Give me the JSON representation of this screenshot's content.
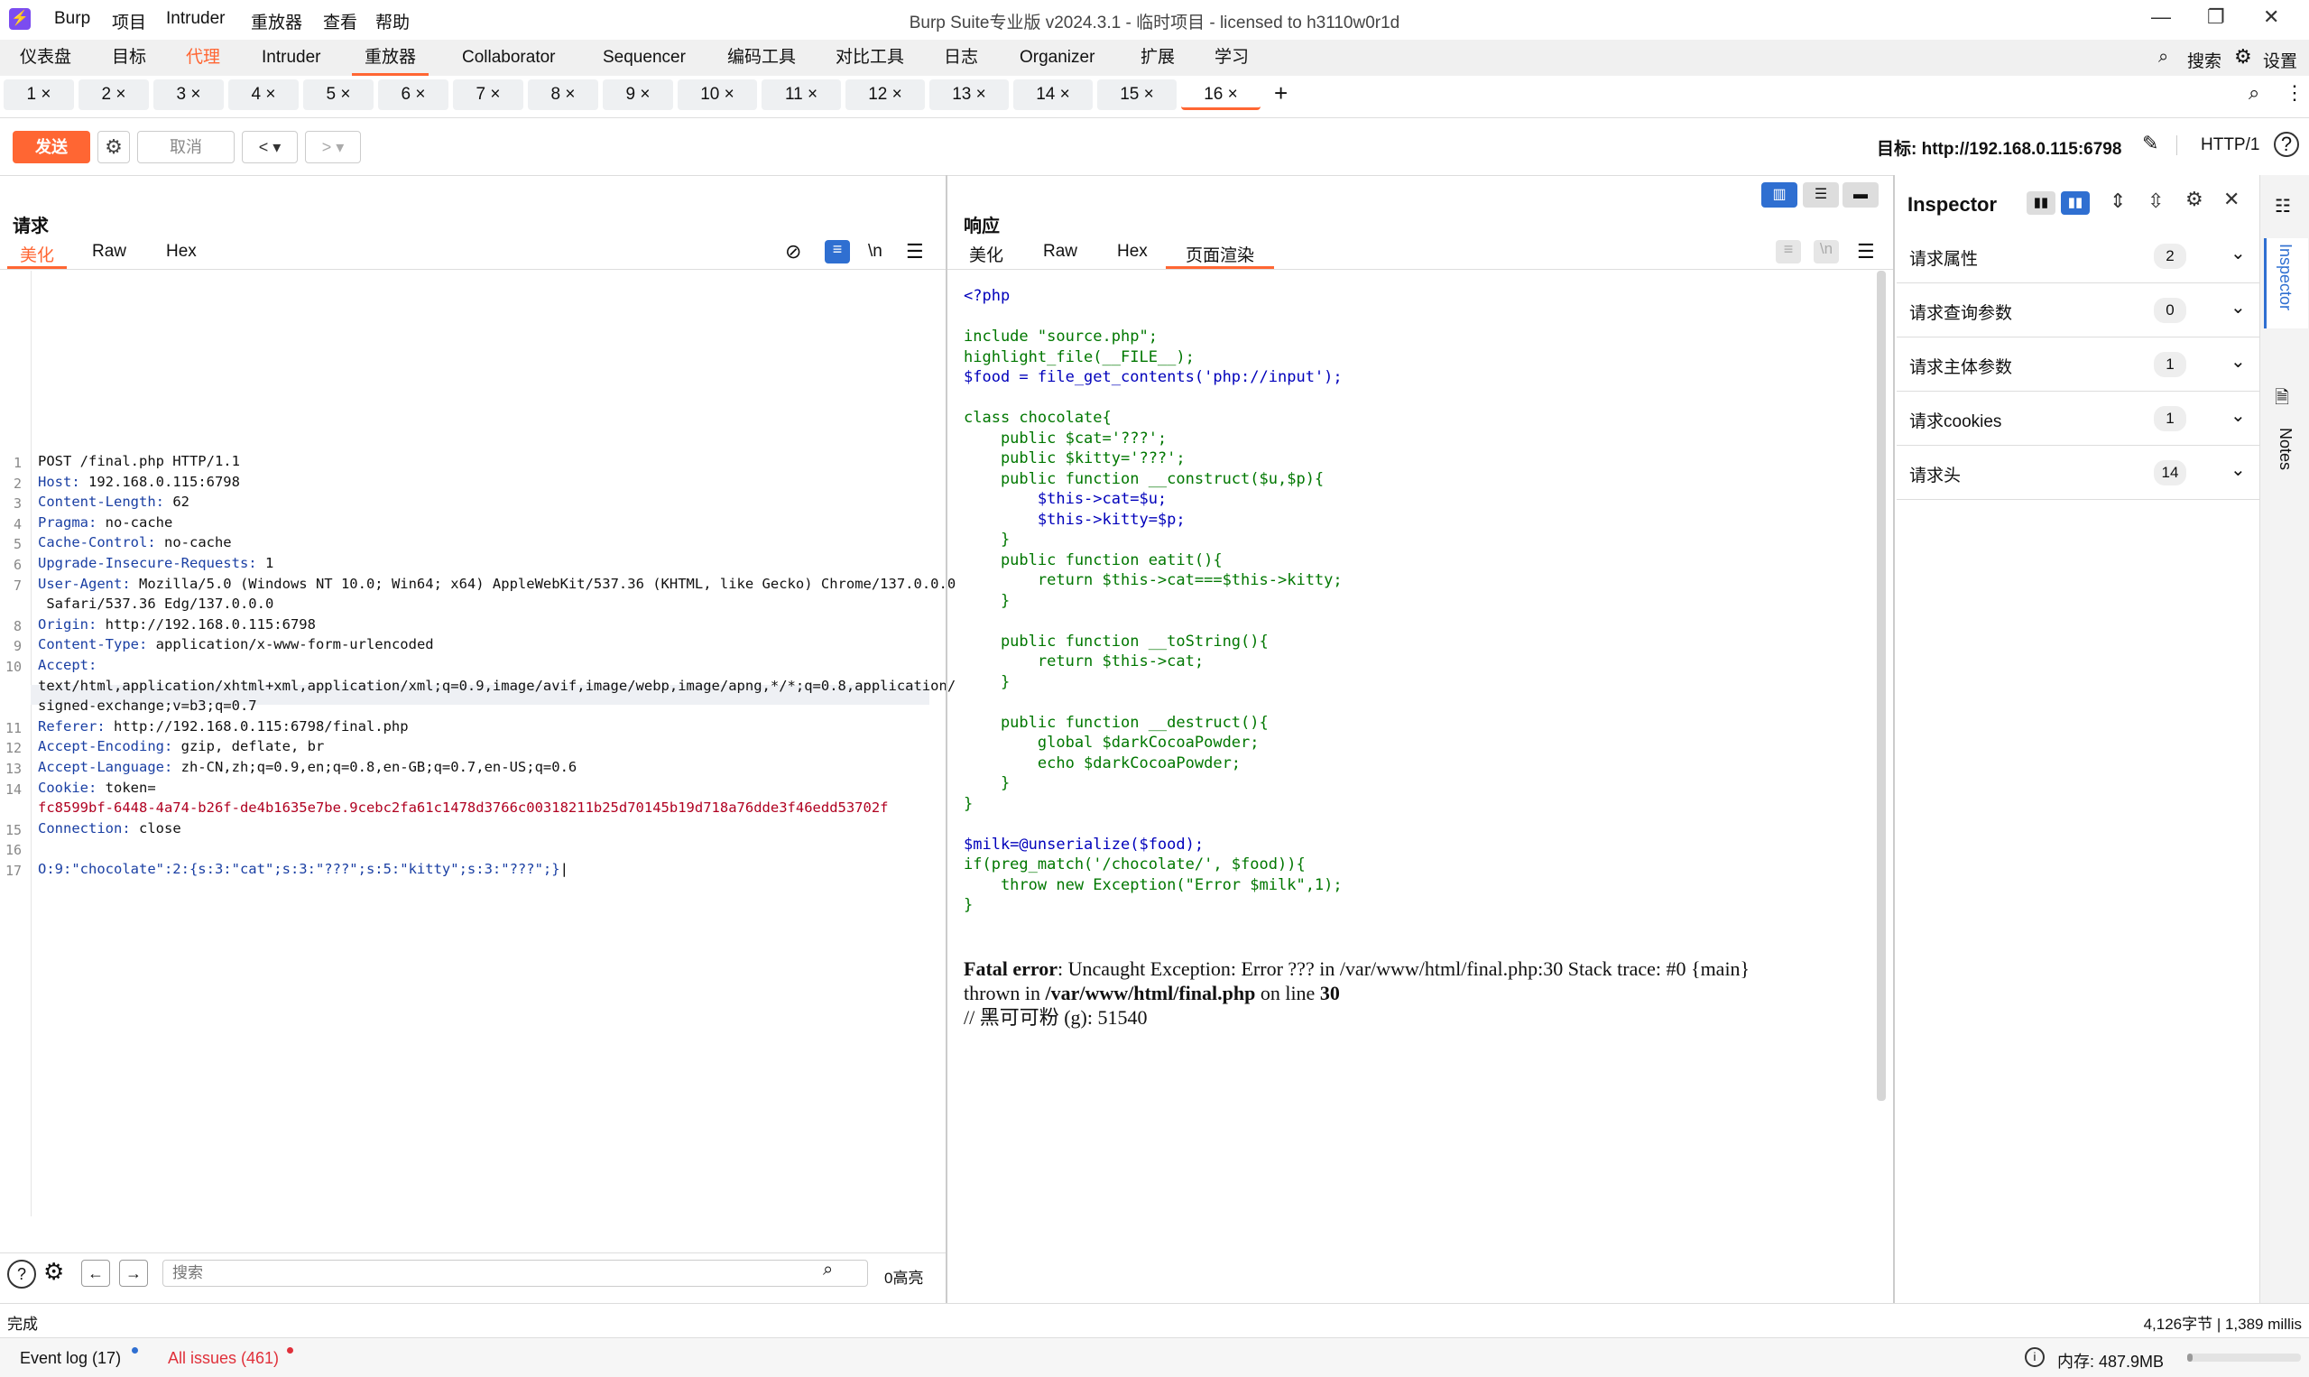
{
  "app": {
    "menu": [
      "Burp",
      "项目",
      "Intruder",
      "重放器",
      "查看",
      "帮助"
    ],
    "title": "Burp Suite专业版  v2024.3.1 - 临时项目 - licensed to h3110w0r1d"
  },
  "main_tabs": [
    "仪表盘",
    "目标",
    "代理",
    "Intruder",
    "重放器",
    "Collaborator",
    "Sequencer",
    "编码工具",
    "对比工具",
    "日志",
    "Organizer",
    "扩展",
    "学习"
  ],
  "top_right": {
    "search": "搜索",
    "settings": "设置"
  },
  "repeater_tabs": [
    "1",
    "2",
    "3",
    "4",
    "5",
    "6",
    "7",
    "8",
    "9",
    "10",
    "11",
    "12",
    "13",
    "14",
    "15",
    "16"
  ],
  "toolbar": {
    "send": "发送",
    "cancel": "取消",
    "target": "目标: http://192.168.0.115:6798",
    "http": "HTTP/1"
  },
  "request": {
    "title": "请求",
    "tabs": [
      "美化",
      "Raw",
      "Hex"
    ],
    "newline_btn": "\\n",
    "lines": [
      {
        "n": "1",
        "k": "",
        "v": "POST /final.php HTTP/1.1"
      },
      {
        "n": "2",
        "k": "Host:",
        "v": " 192.168.0.115:6798"
      },
      {
        "n": "3",
        "k": "Content-Length:",
        "v": " 62"
      },
      {
        "n": "4",
        "k": "Pragma:",
        "v": " no-cache"
      },
      {
        "n": "5",
        "k": "Cache-Control:",
        "v": " no-cache"
      },
      {
        "n": "6",
        "k": "Upgrade-Insecure-Requests:",
        "v": " 1"
      },
      {
        "n": "7",
        "k": "User-Agent:",
        "v": " Mozilla/5.0 (Windows NT 10.0; Win64; x64) AppleWebKit/537.36 (KHTML, like Gecko) Chrome/137.0.0.0"
      },
      {
        "n": "",
        "k": "",
        "v": " Safari/537.36 Edg/137.0.0.0"
      },
      {
        "n": "8",
        "k": "Origin:",
        "v": " http://192.168.0.115:6798"
      },
      {
        "n": "9",
        "k": "Content-Type:",
        "v": " application/x-www-form-urlencoded"
      },
      {
        "n": "10",
        "k": "Accept:",
        "v": ""
      },
      {
        "n": "",
        "k": "",
        "v": "text/html,application/xhtml+xml,application/xml;q=0.9,image/avif,image/webp,image/apng,*/*;q=0.8,application/"
      },
      {
        "n": "",
        "k": "",
        "v": "signed-exchange;v=b3;q=0.7"
      },
      {
        "n": "11",
        "k": "Referer:",
        "v": " http://192.168.0.115:6798/final.php"
      },
      {
        "n": "12",
        "k": "Accept-Encoding:",
        "v": " gzip, deflate, br"
      },
      {
        "n": "13",
        "k": "Accept-Language:",
        "v": " zh-CN,zh;q=0.9,en;q=0.8,en-GB;q=0.7,en-US;q=0.6"
      },
      {
        "n": "14",
        "k": "Cookie:",
        "v": " token="
      },
      {
        "n": "",
        "k": "",
        "v": "fc8599bf-6448-4a74-b26f-de4b1635e7be.9cebc2fa61c1478d3766c00318211b25d70145b19d718a76dde3f46edd53702f",
        "red": true
      },
      {
        "n": "15",
        "k": "Connection:",
        "v": " close"
      },
      {
        "n": "16",
        "k": "",
        "v": ""
      },
      {
        "n": "17",
        "k": "",
        "v": "O:9:\"chocolate\":2:{s:3:\"cat\";s:3:\"???\";s:5:\"kitty\";s:3:\"???\";}",
        "body": true
      }
    ],
    "search_placeholder": "搜索",
    "highlight": "0高亮"
  },
  "response": {
    "title": "响应",
    "tabs": [
      "美化",
      "Raw",
      "Hex",
      "页面渲染"
    ],
    "code": [
      "<?php",
      "",
      "include \"source.php\";",
      "highlight_file(__FILE__);",
      "$food = file_get_contents('php://input');",
      "",
      "class chocolate{",
      "    public $cat='???';",
      "    public $kitty='???';",
      "    public function __construct($u,$p){",
      "        $this->cat=$u;",
      "        $this->kitty=$p;",
      "    }",
      "    public function eatit(){",
      "        return $this->cat===$this->kitty;",
      "    }",
      "",
      "    public function __toString(){",
      "        return $this->cat;",
      "    }",
      "",
      "    public function __destruct(){",
      "        global $darkCocoaPowder;",
      "        echo $darkCocoaPowder;",
      "    }",
      "}",
      "",
      "$milk=@unserialize($food);",
      "if(preg_match('/chocolate/', $food)){",
      "    throw new Exception(\"Error $milk\",1);",
      "}"
    ],
    "fatal_label": "Fatal error",
    "fatal_text": ": Uncaught Exception: Error ??? in /var/www/html/final.php:30 Stack trace: #0 {main}",
    "thrown_a": "thrown in ",
    "thrown_path": "/var/www/html/final.php",
    "thrown_b": " on line ",
    "thrown_line": "30",
    "comment": "// 黑可可粉 (g): 51540"
  },
  "inspector": {
    "title": "Inspector",
    "rows": [
      {
        "label": "请求属性",
        "count": "2"
      },
      {
        "label": "请求查询参数",
        "count": "0"
      },
      {
        "label": "请求主体参数",
        "count": "1"
      },
      {
        "label": "请求cookies",
        "count": "1"
      },
      {
        "label": "请求头",
        "count": "14"
      }
    ],
    "side_tabs": [
      "Inspector",
      "Notes"
    ]
  },
  "status": {
    "left": "完成",
    "right": "4,126字节 | 1,389 millis"
  },
  "bottom": {
    "event_log": "Event log (17)",
    "all_issues": "All issues (461)",
    "memory": "内存: 487.9MB"
  },
  "colors": {
    "accent": "#ff6633",
    "key": "#1a3fa3",
    "cookie": "#b00020"
  }
}
